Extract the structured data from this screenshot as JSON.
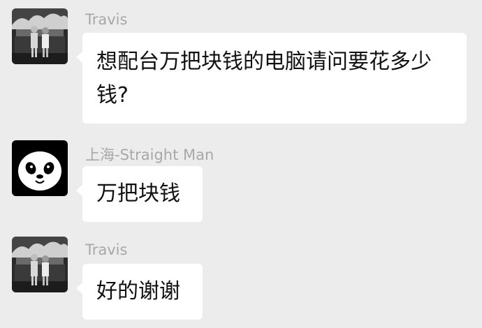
{
  "messages": [
    {
      "sender": "Travis",
      "avatar_icon": "photo-avatar",
      "text": "想配台万把块钱的电脑请问要花多少钱?"
    },
    {
      "sender": "上海-Straight Man",
      "avatar_icon": "panda-avatar",
      "text": "万把块钱"
    },
    {
      "sender": "Travis",
      "avatar_icon": "photo-avatar",
      "text": "好的谢谢"
    }
  ],
  "colors": {
    "background": "#ececec",
    "bubble": "#ffffff",
    "sender_name": "#a8a8a8",
    "message_text": "#111111"
  }
}
